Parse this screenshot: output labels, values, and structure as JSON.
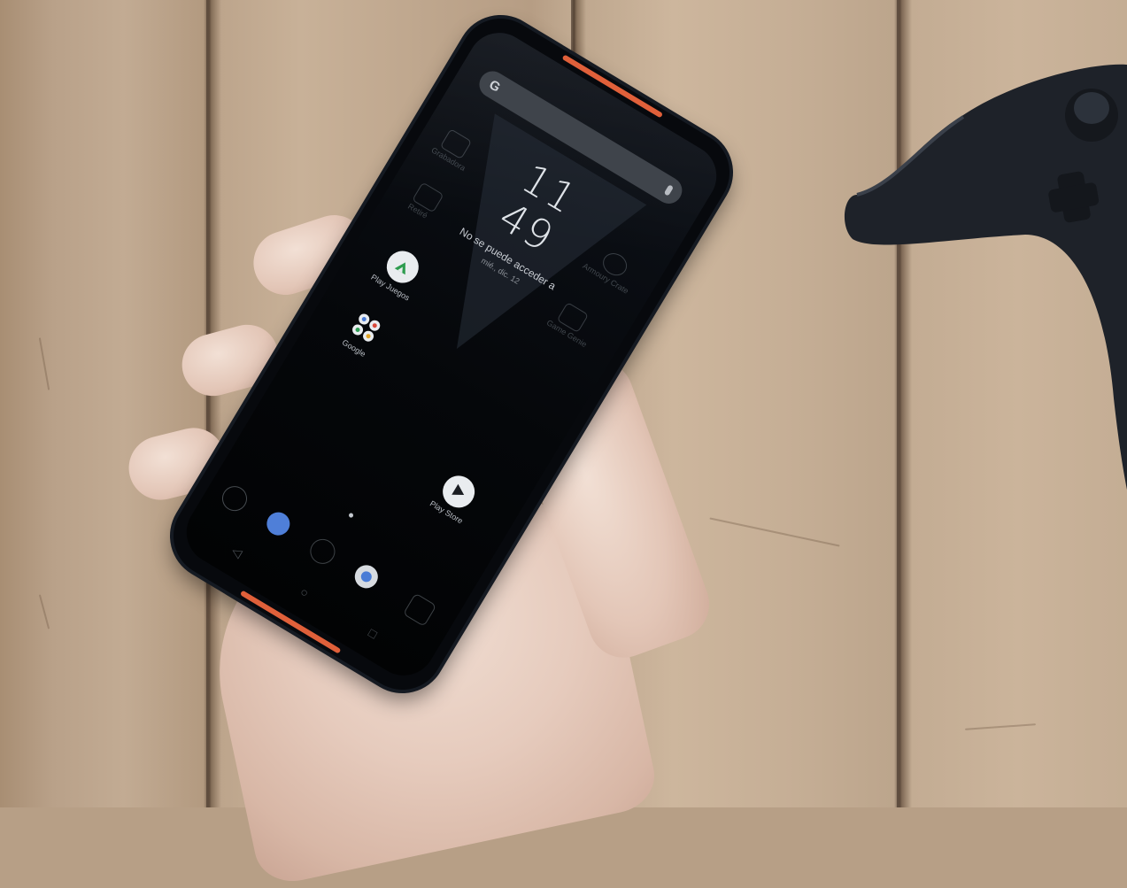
{
  "scene": {
    "description_colors": {
      "wood": "#c3ab92",
      "phone_body": "#07090d",
      "vent_accent": "#e0603a",
      "controller": "#1f232a"
    }
  },
  "phone": {
    "search": {
      "logo": "G"
    },
    "clock": {
      "hours": "11",
      "minutes": "49"
    },
    "weather": {
      "text": "No se puede acceder a",
      "date": "mié., dic. 12"
    },
    "apps": [
      {
        "label": "Play Juegos",
        "icon": "play-games-icon"
      },
      {
        "label": "Google",
        "icon": "google-folder-icon"
      },
      {
        "label": "Play Store",
        "icon": "play-store-icon"
      }
    ],
    "ghost_apps": [
      {
        "label": "Grabadora"
      },
      {
        "label": "Retiré"
      },
      {
        "label": "Armoury Crate"
      },
      {
        "label": "Game Genie"
      }
    ],
    "dock": [
      "phone-icon",
      "messages-icon",
      "settings-icon",
      "chrome-icon",
      "camera-icon"
    ],
    "navbar": [
      "back-icon",
      "home-icon",
      "recents-icon"
    ]
  }
}
